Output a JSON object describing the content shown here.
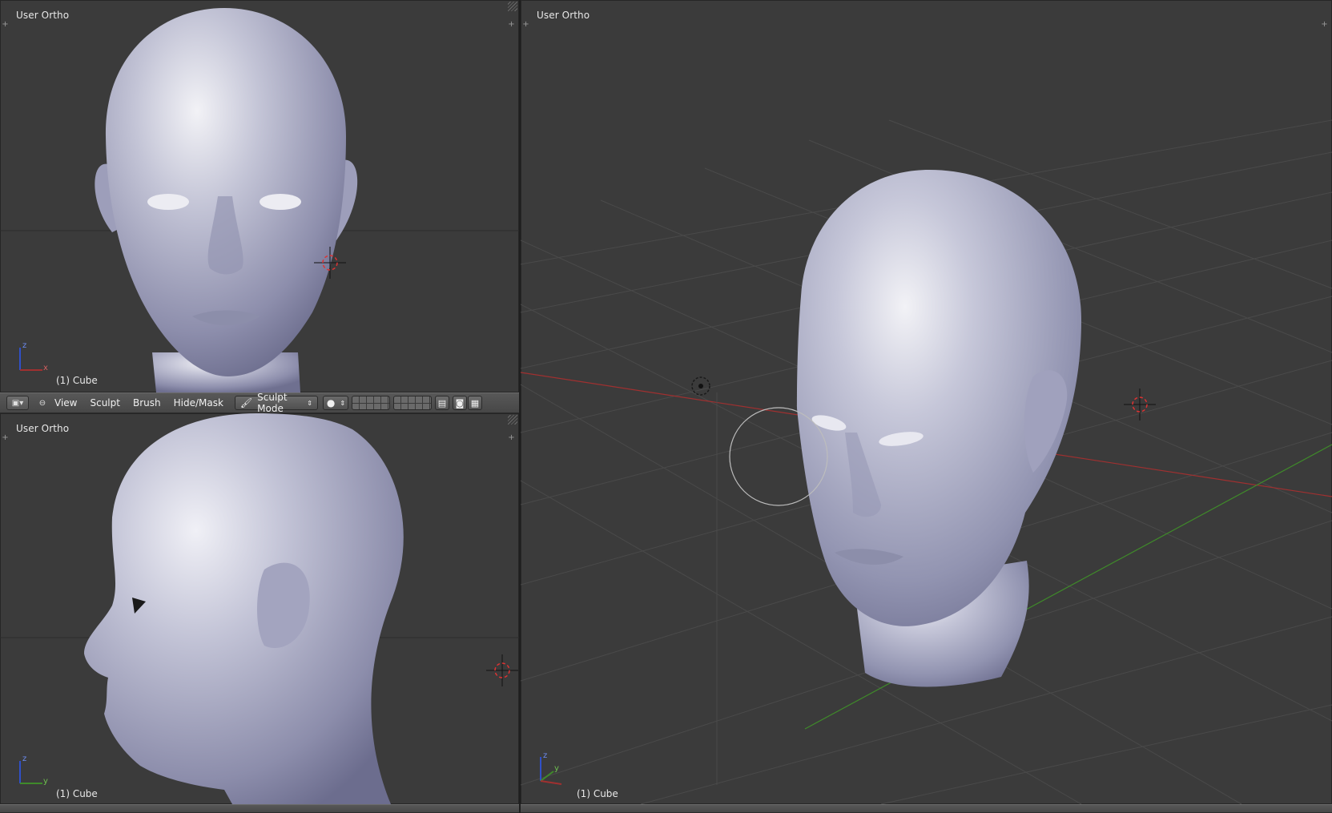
{
  "viewports": {
    "top_left": {
      "title": "User Ortho",
      "object_label": "(1) Cube"
    },
    "bottom_left": {
      "title": "User Ortho",
      "object_label": "(1) Cube"
    },
    "right": {
      "title": "User Ortho",
      "object_label": "(1) Cube"
    }
  },
  "header": {
    "menus": [
      "View",
      "Sculpt",
      "Brush",
      "Hide/Mask"
    ],
    "mode_label": "Sculpt Mode"
  },
  "axis_labels": {
    "z": "z",
    "x": "x",
    "y": "y"
  },
  "colors": {
    "viewport_bg": "#3b3b3b",
    "grid_line": "#4a4a4a",
    "x_axis": "#a03030",
    "y_axis": "#3f8a2a",
    "z_axis": "#3050c8",
    "head_base": "#a8a9c4",
    "head_highlight": "#e6e6ee"
  },
  "icons": [
    "editor-type-icon",
    "viewport-shading-icon",
    "brush-icon",
    "layer-grid-icon",
    "camera-icon",
    "render-icon",
    "3d-cursor-icon",
    "light-icon"
  ]
}
